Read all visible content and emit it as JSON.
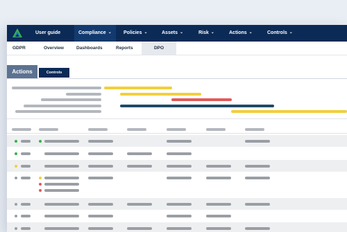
{
  "nav": {
    "items": [
      {
        "label": "User guide",
        "has_menu": false
      },
      {
        "label": "Compliance",
        "has_menu": true,
        "active": true
      },
      {
        "label": "Policies",
        "has_menu": true
      },
      {
        "label": "Assets",
        "has_menu": true
      },
      {
        "label": "Risk",
        "has_menu": true
      },
      {
        "label": "Actions",
        "has_menu": true
      },
      {
        "label": "Controls",
        "has_menu": true
      }
    ],
    "chevron": "⌄"
  },
  "subnav": {
    "items": [
      "GDPR",
      "Overview",
      "Dashboards",
      "Reports",
      "DPO"
    ],
    "active": "DPO"
  },
  "tabs": {
    "actions_label": "Actions",
    "controls_label": "Controls"
  },
  "colors": {
    "nav_bg": "#0b2a56",
    "gantt_yellow": "#f2cf3a",
    "gantt_red": "#e05a5a",
    "gantt_navy": "#1f4a66",
    "status_green": "#36b24a",
    "status_yellow": "#f2cf3a",
    "status_red": "#e05a5a",
    "status_grey": "#9a9ea4"
  },
  "icons": {
    "logo": "app-logo-icon",
    "chevron": "chevron-down-icon"
  }
}
